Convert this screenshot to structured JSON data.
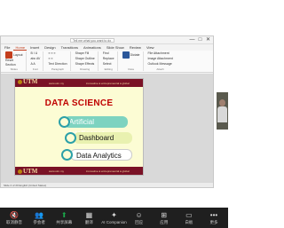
{
  "ppt": {
    "search_placeholder": "Tell me what you want to do",
    "window_controls": [
      "—",
      "□",
      "✕"
    ],
    "tabs": [
      "File",
      "Home",
      "Insert",
      "Design",
      "Transitions",
      "Animations",
      "Slide Show",
      "Review",
      "View"
    ],
    "ribbon_groups": [
      {
        "rows": [
          "Layout",
          "Reset",
          "Section"
        ],
        "label": "Slides"
      },
      {
        "rows": [
          "B I U",
          "abc AV",
          "A A"
        ],
        "label": "Font"
      },
      {
        "rows": [
          "≡ ≡ ≡",
          "≡ ≡",
          "Text Direction"
        ],
        "label": "Paragraph"
      },
      {
        "rows": [
          "Shape Fill",
          "Shape Outline",
          "Shape Effects"
        ],
        "label": "Drawing"
      },
      {
        "rows": [
          "Find",
          "Replace",
          "Select"
        ],
        "label": "Editing"
      },
      {
        "rows": [
          "Dictate",
          "",
          ""
        ],
        "label": "Voice"
      },
      {
        "rows": [
          "File Attachment",
          "Image Attachment",
          "Outlook Message"
        ],
        "label": "Attach"
      }
    ],
    "status_text": "Slide 2 of 20   English (United States)"
  },
  "slide": {
    "logo_top": "UTM",
    "logo_bottom": "UTM",
    "band_text_top": "www.utm.my",
    "band_text_right_top": "innovative ● entrepreneurial ● global",
    "band_text_bottom": "www.utm.my",
    "band_text_right_bottom": "innovative ● entrepreneurial ● global",
    "title": "DATA SCIENCE",
    "items": [
      "Artificial Intelligence",
      "Dashboard",
      "Data Analytics"
    ]
  },
  "zoom_toolbar": [
    {
      "icon": "🔇",
      "label": "取消静音",
      "icon_name": "mic-muted-icon"
    },
    {
      "icon": "👥",
      "label": "参会者",
      "icon_name": "participants-icon"
    },
    {
      "icon": "⬆",
      "label": "共享屏幕",
      "icon_name": "share-screen-icon",
      "green": true
    },
    {
      "icon": "▦",
      "label": "翻译",
      "icon_name": "translate-icon"
    },
    {
      "icon": "✦",
      "label": "AI Companion",
      "icon_name": "ai-companion-icon"
    },
    {
      "icon": "☺",
      "label": "回应",
      "icon_name": "reactions-icon"
    },
    {
      "icon": "⊞",
      "label": "应用",
      "icon_name": "apps-icon"
    },
    {
      "icon": "▭",
      "label": "白板",
      "icon_name": "whiteboard-icon"
    },
    {
      "icon": "•••",
      "label": "更多",
      "icon_name": "more-icon"
    }
  ]
}
